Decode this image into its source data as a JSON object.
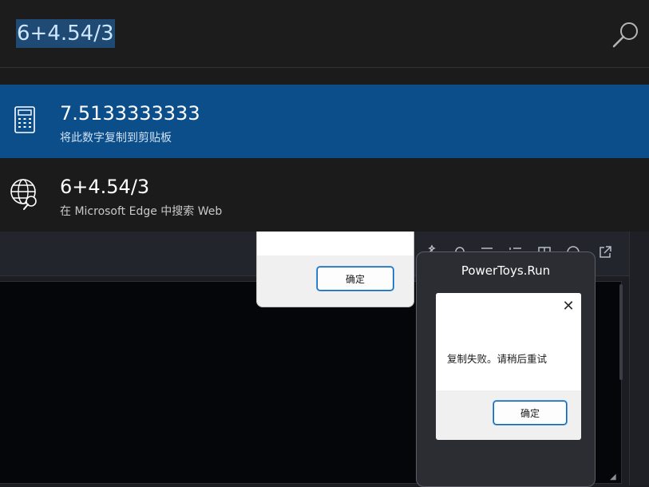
{
  "launcher": {
    "query": "6+4.54/3",
    "results": [
      {
        "title": "7.5133333333",
        "subtitle": "将此数字复制到剪贴板",
        "icon": "calculator-icon",
        "selected": true
      },
      {
        "title": "6+4.54/3",
        "subtitle": "在 Microsoft Edge 中搜索 Web",
        "icon": "globe-search-icon",
        "selected": false
      }
    ],
    "accent_color": "#0b4e8a"
  },
  "dialog_back": {
    "ok_label": "确定"
  },
  "error_window": {
    "title": "PowerToys.Run",
    "message": "复制失败。请稍后重试",
    "ok_label": "确定"
  }
}
